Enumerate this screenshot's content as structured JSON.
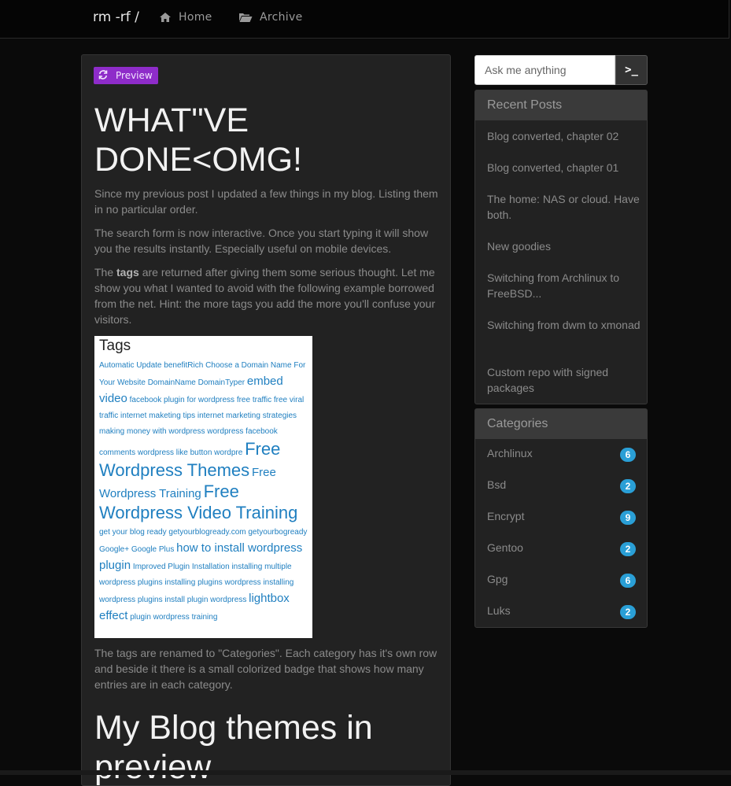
{
  "nav": {
    "brand": "rm -rf /",
    "home_label": "Home",
    "archive_label": "Archive"
  },
  "post": {
    "badge_label": "Preview",
    "title": "WHAT\"VE DONE<OMG!",
    "paragraphs": [
      "Since my previous post I updated a few things in my blog. Listing them in no particular order.",
      "The search form is now interactive. Once you start typing it will show you the results instantly. Especially useful on mobile devices."
    ],
    "p3_before": "The ",
    "p3_bold": "tags",
    "p3_after": " are returned after giving them some serious thought. Let me show you what I wanted to avoid with the following example borrowed from the net. Hint: the more tags you add the more you'll confuse your visitors.",
    "p4": "The tags are renamed to \"Categories\". Each category has it's own row and beside it there is a small colorized badge that shows how many entries are in each category.",
    "title2": "My Blog themes in preview"
  },
  "tag_image": {
    "title": "Tags",
    "tags": [
      {
        "text": "Automatic Update benefitRich Choose a Domain Name For Your Website DomainName DomainTyper",
        "size": "s"
      },
      {
        "text": "embed video",
        "size": "m"
      },
      {
        "text": "facebook plugin for wordpress free traffic free viral traffic internet maketing tips internet marketing strategies making money with wordpress wordpress facebook comments wordpress like button wordpre",
        "size": "s"
      },
      {
        "text": "Free Wordpress Themes",
        "size": "l"
      },
      {
        "text": "Free Wordpress Training",
        "size": "m"
      },
      {
        "text": "Free Wordpress Video Training",
        "size": "l"
      },
      {
        "text": "get your blog ready getyourblogready.com getyourbogready Google+ Google Plus",
        "size": "s"
      },
      {
        "text": "how to install wordpress plugin",
        "size": "m"
      },
      {
        "text": "Improved Plugin Installation installing multiple wordpress plugins installing plugins wordpress installing wordpress plugins install plugin wordpress",
        "size": "s"
      },
      {
        "text": "lightbox effect",
        "size": "m"
      },
      {
        "text": "plugin wordpress training",
        "size": "s"
      }
    ]
  },
  "search": {
    "placeholder": "Ask me anything",
    "button_label": ">_"
  },
  "recent_posts": {
    "heading": "Recent Posts",
    "items": [
      "Blog converted, chapter 02",
      "Blog converted, chapter 01",
      "The home: NAS or cloud. Have both.",
      "New goodies",
      "Switching from Archlinux to FreeBSD...",
      "Switching from dwm to xmonad",
      "Custom repo with signed packages"
    ]
  },
  "categories": {
    "heading": "Categories",
    "items": [
      {
        "name": "Archlinux",
        "count": "6"
      },
      {
        "name": "Bsd",
        "count": "2"
      },
      {
        "name": "Encrypt",
        "count": "9"
      },
      {
        "name": "Gentoo",
        "count": "2"
      },
      {
        "name": "Gpg",
        "count": "6"
      },
      {
        "name": "Luks",
        "count": "2"
      }
    ]
  },
  "colors": {
    "badge_purple": "#8e2cc9",
    "count_badge_blue": "#2a9fd6",
    "link_blue": "#1f7fc0"
  },
  "icons": {
    "home": "home-icon",
    "archive": "folder-open-icon",
    "preview": "refresh-icon",
    "search_button": "terminal-icon"
  }
}
